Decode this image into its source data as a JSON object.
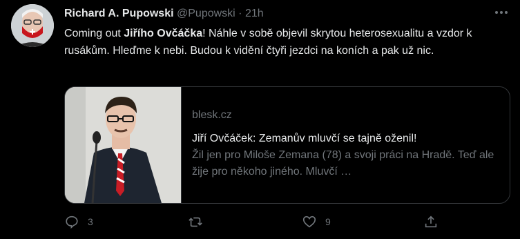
{
  "tweet": {
    "author_name": "Richard A. Pupowski",
    "author_handle": "@Pupowski",
    "separator": "·",
    "time": "21h",
    "text_before": "Coming out ",
    "text_bold": "Jiřího Ovčáčka",
    "text_after": "! Náhle v sobě objevil skrytou heterosexualitu a vzdor k rusákům. Hleďme k nebi. Budou k vidění čtyři jezdci na koních a pak už nic."
  },
  "card": {
    "domain": "blesk.cz",
    "title": "Jiří Ovčáček: Zemanův mluvčí se tajně oženil!",
    "description": "Žil jen pro Miloše Zemana (78) a svoji práci na Hradě. Teď ale žije pro někoho jiného. Mluvčí …"
  },
  "actions": {
    "reply_count": "3",
    "retweet_count": "",
    "like_count": "9"
  },
  "icons": {
    "more": "more-icon",
    "reply": "reply-icon",
    "retweet": "retweet-icon",
    "like": "like-icon",
    "share": "share-icon"
  },
  "colors": {
    "background": "#000000",
    "text": "#e7e9ea",
    "secondary": "#71767b",
    "border": "#333639"
  }
}
